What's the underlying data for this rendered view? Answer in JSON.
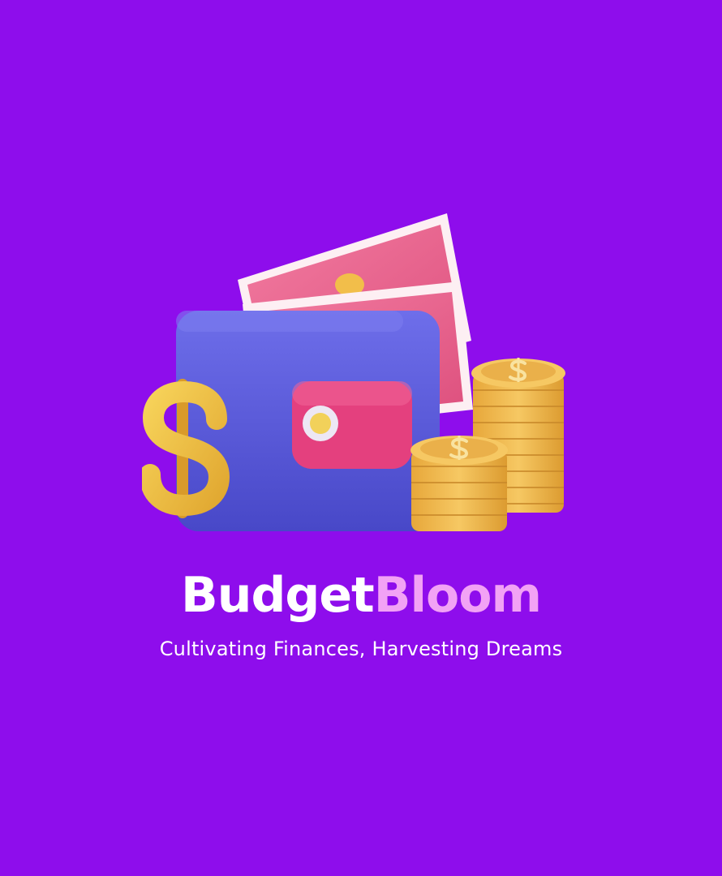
{
  "brand": {
    "name_part_1": "Budget",
    "name_part_2": "Bloom",
    "tagline": "Cultivating Finances, Harvesting Dreams"
  },
  "colors": {
    "background": "#8E0DEC",
    "name_part_1": "#FFFFFF",
    "name_part_2": "#F2A2F5",
    "tagline": "#FFFFFF",
    "wallet": "#5B5BE0",
    "banknote": "#E9628C",
    "coin": "#F2BE4A"
  },
  "icons": {
    "illustration": "wallet-with-money-and-coins-icon",
    "dollar_sign": "dollar-sign-icon",
    "coin_stack": "coin-stack-icon",
    "banknote": "banknote-icon"
  }
}
